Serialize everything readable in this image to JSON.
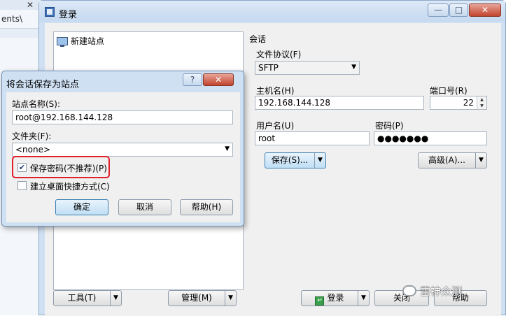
{
  "background_window": {
    "text": "ents\\",
    "close_glyph": "✕"
  },
  "window": {
    "title": "登录",
    "buttons": {
      "minimize": "—",
      "maximize": "□",
      "close": "✕"
    }
  },
  "sites": {
    "items": [
      "新建站点"
    ]
  },
  "session": {
    "group_label": "会话",
    "protocol_label": "文件协议(F)",
    "protocol_value": "SFTP",
    "host_label": "主机名(H)",
    "host_value": "192.168.144.128",
    "port_label": "端口号(R)",
    "port_value": "22",
    "user_label": "用户名(U)",
    "user_value": "root",
    "password_label": "密码(P)",
    "password_value": "●●●●●●●",
    "save_button": "保存(S)...",
    "advanced_button": "高级(A)..."
  },
  "bottom": {
    "tools_button": "工具(T)",
    "manage_button": "管理(M)",
    "login_button": "登录",
    "close_button": "关闭",
    "help_button": "帮助"
  },
  "dialog": {
    "title": "将会话保存为站点",
    "help_glyph": "?",
    "close_glyph": "✕",
    "site_name_label": "站点名称(S):",
    "site_name_value": "root@192.168.144.128",
    "folder_label": "文件夹(F):",
    "folder_value": "<none>",
    "save_password_label": "保存密码(不推荐)(P)",
    "save_password_checked": true,
    "create_shortcut_label": "建立桌面快捷方式(C)",
    "create_shortcut_checked": false,
    "ok_button": "确定",
    "cancel_button": "取消",
    "help_button": "帮助(H)",
    "highlight_color": "#e0202a"
  },
  "watermark": {
    "text": "雷神众测"
  }
}
